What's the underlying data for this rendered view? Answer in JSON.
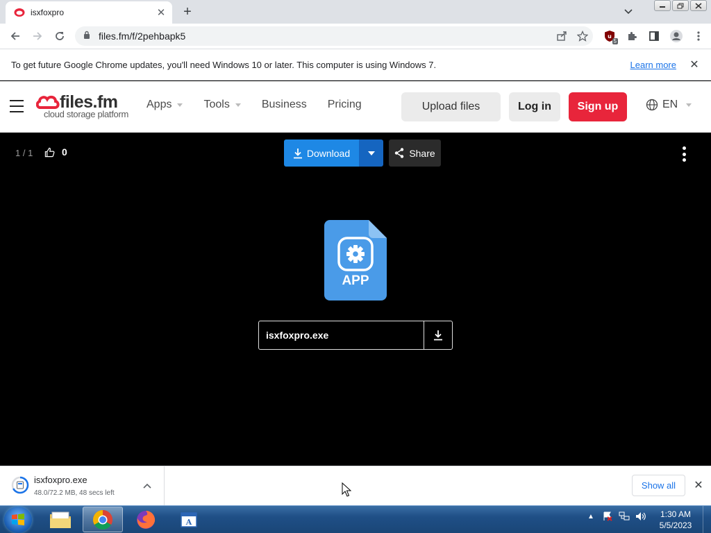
{
  "browser": {
    "tab_title": "isxfoxpro",
    "new_tab": "+",
    "url": "files.fm/f/2pehbapk5",
    "extension_badge": "5"
  },
  "infobar": {
    "message": "To get future Google Chrome updates, you'll need Windows 10 or later. This computer is using Windows 7.",
    "link": "Learn more"
  },
  "site": {
    "logo_name": "files.fm",
    "logo_tagline": "cloud storage platform",
    "nav": {
      "apps": "Apps",
      "tools": "Tools",
      "business": "Business",
      "pricing": "Pricing"
    },
    "upload_button": "Upload files",
    "login_button": "Log in",
    "signup_button": "Sign up",
    "language": "EN",
    "brand_color": "#e8253b"
  },
  "viewer": {
    "counter": "1 / 1",
    "likes": "0",
    "download_button": "Download",
    "share_button": "Share",
    "file_type_label": "APP",
    "file_name": "isxfoxpro.exe",
    "accent_color": "#1e88e5"
  },
  "downloads": {
    "file_name": "isxfoxpro.exe",
    "status": "48.0/72.2 MB, 48 secs left",
    "show_all": "Show all"
  },
  "taskbar": {
    "time": "1:30 AM",
    "date": "5/5/2023"
  }
}
